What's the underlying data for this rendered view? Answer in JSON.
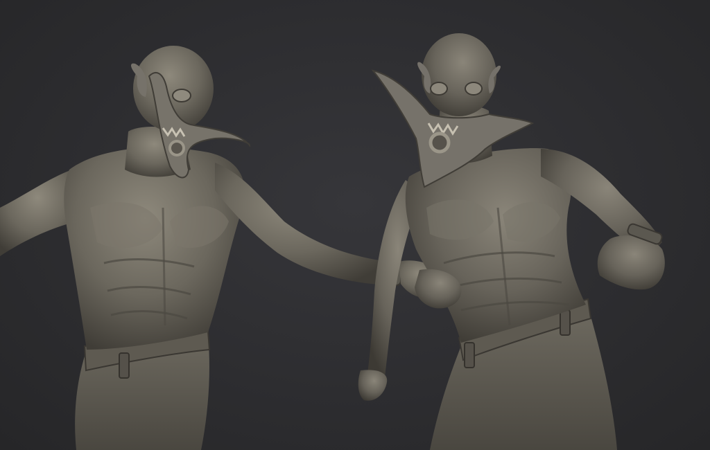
{
  "scene": {
    "background_color": "#2c2c2e",
    "clay_color": "#6e6a60",
    "clay_highlight": "#8c877b",
    "clay_shadow": "#3f3c36"
  }
}
